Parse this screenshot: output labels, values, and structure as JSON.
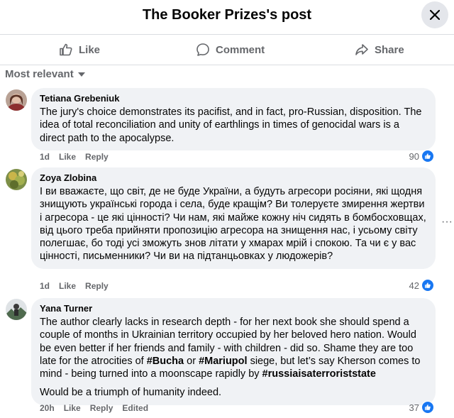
{
  "header": {
    "title": "The Booker Prizes's post"
  },
  "actions": {
    "like": "Like",
    "comment": "Comment",
    "share": "Share"
  },
  "sort": {
    "label": "Most relevant"
  },
  "comments": [
    {
      "author": "Tetiana Grebeniuk",
      "text": "The jury's choice demonstrates its pacifist, and in fact, pro-Russian, disposition. The idea of total reconciliation and unity of earthlings in times of genocidal wars is a direct path to the apocalypse.",
      "time": "1d",
      "like": "Like",
      "reply": "Reply",
      "reactions": "90"
    },
    {
      "author": "Zoya Zlobina",
      "text": "І ви вважаєте, що світ, де не буде України, а будуть агресори росіяни, які щодня знищують українські города і села, буде кращім? Ви толеруєте змирення жертви і агресора - це які цінності? Чи нам, які майже кожну ніч сидять в бомбосховщах, від цього треба прийняти пропозицію агресора на знищення нас, і усьому світу полегшає, бо тоді усі зможуть знов літати у хмарах мрій і спокою. Та чи є у вас цінності, письменники? Чи ви на підтанцьовках у людожерів?",
      "time": "1d",
      "like": "Like",
      "reply": "Reply",
      "reactions": "42",
      "more": "···"
    },
    {
      "author": "Yana Turner",
      "text_parts": [
        "The author clearly lacks in research depth - for her next book she should spend a couple of months in Ukrainian territory occupied by her beloved hero nation. Would be even better if her friends and family - with children - did so. Shame they are too late for the atrocities of ",
        "#Bucha",
        " or ",
        "#Mariupol",
        " siege, but let’s say Kherson comes to mind - being turned into a moonscape rapidly by ",
        "#russiaisaterroriststate"
      ],
      "text2": "Would be a triumph of humanity indeed.",
      "time": "20h",
      "like": "Like",
      "reply": "Reply",
      "edited": "Edited",
      "reactions": "37"
    }
  ]
}
